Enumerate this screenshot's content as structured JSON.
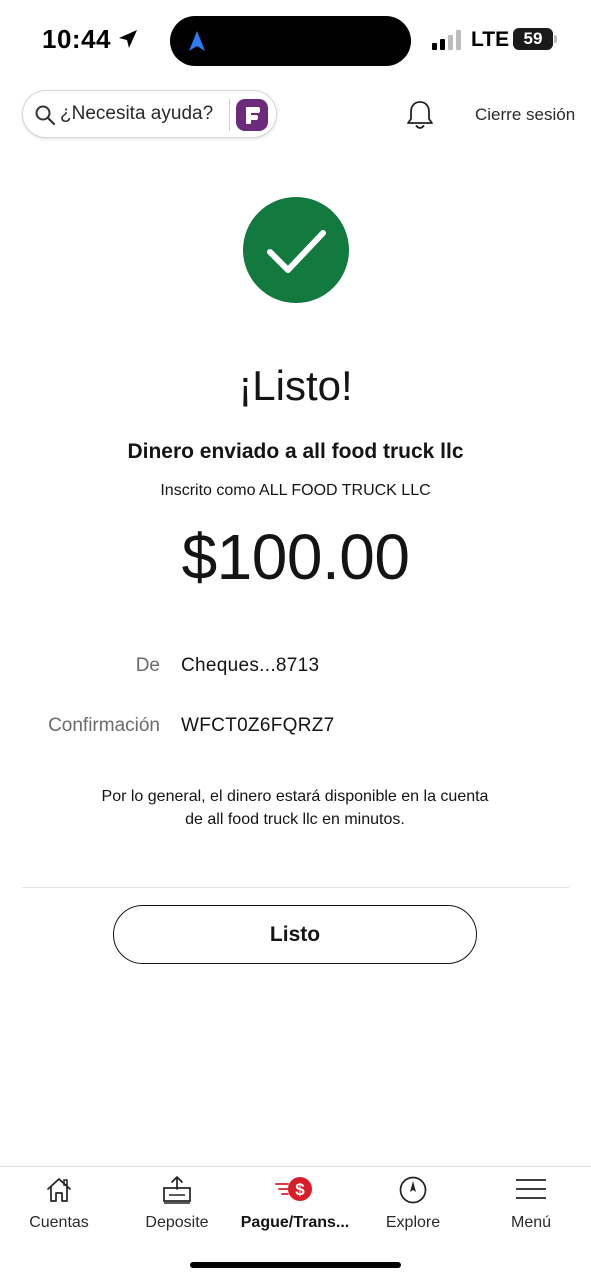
{
  "status_bar": {
    "time": "10:44",
    "network": "LTE",
    "battery": "59"
  },
  "header": {
    "help_text": "¿Necesita ayuda?",
    "logout_label": "Cierre sesión",
    "icons": [
      "search-icon",
      "fargo-assistant-icon",
      "bell-icon"
    ]
  },
  "confirmation": {
    "title": "¡Listo!",
    "sent_to": "Dinero enviado a all food truck llc",
    "enrolled_as": "Inscrito como ALL FOOD TRUCK LLC",
    "amount": "$100.00",
    "from_label": "De",
    "from_value": "Cheques...8713",
    "confirmation_label": "Confirmación",
    "confirmation_value": "WFCT0Z6FQRZ7",
    "notice": "Por lo general, el dinero estará disponible en la cuenta de all food truck llc en minutos.",
    "done_label": "Listo"
  },
  "bottom_nav": {
    "items": [
      {
        "label": "Cuentas",
        "icon": "home-icon"
      },
      {
        "label": "Deposite",
        "icon": "deposit-icon"
      },
      {
        "label": "Pague/Trans...",
        "icon": "pay-transfer-icon",
        "active": true
      },
      {
        "label": "Explore",
        "icon": "compass-icon"
      },
      {
        "label": "Menú",
        "icon": "hamburger-menu-icon"
      }
    ]
  },
  "colors": {
    "success": "#137a3f",
    "brand_red": "#d71e28",
    "fargo_purple": "#6b2a7a"
  }
}
